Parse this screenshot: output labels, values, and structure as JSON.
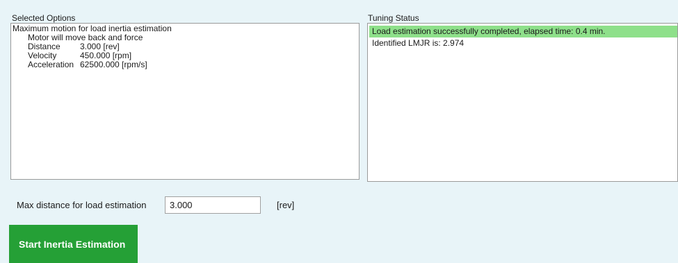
{
  "selected_options": {
    "label": "Selected Options",
    "title": "Maximum motion for load inertia estimation",
    "subtitle": "Motor will move back and force",
    "rows": [
      {
        "key": "Distance",
        "value": "3.000 [rev]"
      },
      {
        "key": "Velocity",
        "value": "450.000 [rpm]"
      },
      {
        "key": "Acceleration",
        "value": "62500.000 [rpm/s]"
      }
    ]
  },
  "tuning_status": {
    "label": "Tuning Status",
    "lines": [
      {
        "text": "Load estimation successfully completed, elapsed time: 0.4 min.",
        "highlight": true
      },
      {
        "text": "Identified LMJR is: 2.974",
        "highlight": false
      }
    ]
  },
  "max_distance": {
    "label": "Max distance for load estimation",
    "value": "3.000",
    "unit": "[rev]"
  },
  "start_button": {
    "label": "Start Inertia Estimation"
  },
  "colors": {
    "background": "#e8f4f8",
    "success_highlight": "#8ee08a",
    "button_green": "#25a036"
  }
}
